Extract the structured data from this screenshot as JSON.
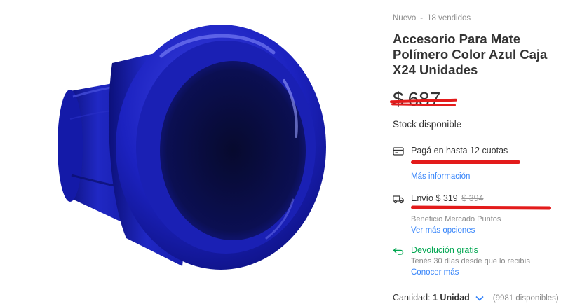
{
  "product": {
    "condition": "Nuevo",
    "separator": "-",
    "sold": "18 vendidos",
    "title": "Accesorio Para Mate Polímero Color Azul Caja X24 Unidades",
    "price_currency": "$",
    "price_value": "687",
    "stock": "Stock disponible"
  },
  "payment": {
    "text": "Pagá en hasta 12 cuotas",
    "link": "Más información"
  },
  "shipping": {
    "label": "Envío",
    "price": "$ 319",
    "old_price": "$ 394",
    "subtext": "Beneficio Mercado Puntos",
    "link": "Ver más opciones"
  },
  "returns": {
    "text": "Devolución gratis",
    "subtext": "Tenés 30 días desde que lo recibís",
    "link": "Conocer más"
  },
  "quantity": {
    "label": "Cantidad:",
    "value": "1 Unidad",
    "available": "(9981 disponibles)"
  },
  "colors": {
    "product_blue": "#1a1fb8",
    "link_blue": "#3483fa",
    "green": "#00a650",
    "markup_red": "#e31b1b"
  }
}
